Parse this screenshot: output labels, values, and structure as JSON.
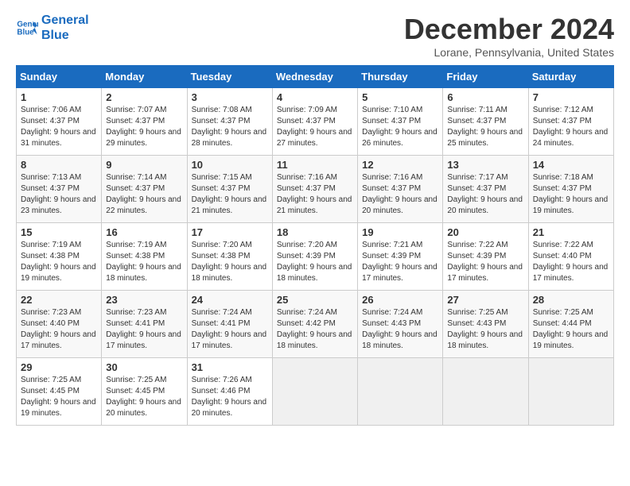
{
  "logo": {
    "line1": "General",
    "line2": "Blue"
  },
  "title": "December 2024",
  "location": "Lorane, Pennsylvania, United States",
  "days_of_week": [
    "Sunday",
    "Monday",
    "Tuesday",
    "Wednesday",
    "Thursday",
    "Friday",
    "Saturday"
  ],
  "weeks": [
    [
      {
        "day": "1",
        "sunrise": "7:06 AM",
        "sunset": "4:37 PM",
        "daylight": "9 hours and 31 minutes."
      },
      {
        "day": "2",
        "sunrise": "7:07 AM",
        "sunset": "4:37 PM",
        "daylight": "9 hours and 29 minutes."
      },
      {
        "day": "3",
        "sunrise": "7:08 AM",
        "sunset": "4:37 PM",
        "daylight": "9 hours and 28 minutes."
      },
      {
        "day": "4",
        "sunrise": "7:09 AM",
        "sunset": "4:37 PM",
        "daylight": "9 hours and 27 minutes."
      },
      {
        "day": "5",
        "sunrise": "7:10 AM",
        "sunset": "4:37 PM",
        "daylight": "9 hours and 26 minutes."
      },
      {
        "day": "6",
        "sunrise": "7:11 AM",
        "sunset": "4:37 PM",
        "daylight": "9 hours and 25 minutes."
      },
      {
        "day": "7",
        "sunrise": "7:12 AM",
        "sunset": "4:37 PM",
        "daylight": "9 hours and 24 minutes."
      }
    ],
    [
      {
        "day": "8",
        "sunrise": "7:13 AM",
        "sunset": "4:37 PM",
        "daylight": "9 hours and 23 minutes."
      },
      {
        "day": "9",
        "sunrise": "7:14 AM",
        "sunset": "4:37 PM",
        "daylight": "9 hours and 22 minutes."
      },
      {
        "day": "10",
        "sunrise": "7:15 AM",
        "sunset": "4:37 PM",
        "daylight": "9 hours and 21 minutes."
      },
      {
        "day": "11",
        "sunrise": "7:16 AM",
        "sunset": "4:37 PM",
        "daylight": "9 hours and 21 minutes."
      },
      {
        "day": "12",
        "sunrise": "7:16 AM",
        "sunset": "4:37 PM",
        "daylight": "9 hours and 20 minutes."
      },
      {
        "day": "13",
        "sunrise": "7:17 AM",
        "sunset": "4:37 PM",
        "daylight": "9 hours and 20 minutes."
      },
      {
        "day": "14",
        "sunrise": "7:18 AM",
        "sunset": "4:37 PM",
        "daylight": "9 hours and 19 minutes."
      }
    ],
    [
      {
        "day": "15",
        "sunrise": "7:19 AM",
        "sunset": "4:38 PM",
        "daylight": "9 hours and 19 minutes."
      },
      {
        "day": "16",
        "sunrise": "7:19 AM",
        "sunset": "4:38 PM",
        "daylight": "9 hours and 18 minutes."
      },
      {
        "day": "17",
        "sunrise": "7:20 AM",
        "sunset": "4:38 PM",
        "daylight": "9 hours and 18 minutes."
      },
      {
        "day": "18",
        "sunrise": "7:20 AM",
        "sunset": "4:39 PM",
        "daylight": "9 hours and 18 minutes."
      },
      {
        "day": "19",
        "sunrise": "7:21 AM",
        "sunset": "4:39 PM",
        "daylight": "9 hours and 17 minutes."
      },
      {
        "day": "20",
        "sunrise": "7:22 AM",
        "sunset": "4:39 PM",
        "daylight": "9 hours and 17 minutes."
      },
      {
        "day": "21",
        "sunrise": "7:22 AM",
        "sunset": "4:40 PM",
        "daylight": "9 hours and 17 minutes."
      }
    ],
    [
      {
        "day": "22",
        "sunrise": "7:23 AM",
        "sunset": "4:40 PM",
        "daylight": "9 hours and 17 minutes."
      },
      {
        "day": "23",
        "sunrise": "7:23 AM",
        "sunset": "4:41 PM",
        "daylight": "9 hours and 17 minutes."
      },
      {
        "day": "24",
        "sunrise": "7:24 AM",
        "sunset": "4:41 PM",
        "daylight": "9 hours and 17 minutes."
      },
      {
        "day": "25",
        "sunrise": "7:24 AM",
        "sunset": "4:42 PM",
        "daylight": "9 hours and 18 minutes."
      },
      {
        "day": "26",
        "sunrise": "7:24 AM",
        "sunset": "4:43 PM",
        "daylight": "9 hours and 18 minutes."
      },
      {
        "day": "27",
        "sunrise": "7:25 AM",
        "sunset": "4:43 PM",
        "daylight": "9 hours and 18 minutes."
      },
      {
        "day": "28",
        "sunrise": "7:25 AM",
        "sunset": "4:44 PM",
        "daylight": "9 hours and 19 minutes."
      }
    ],
    [
      {
        "day": "29",
        "sunrise": "7:25 AM",
        "sunset": "4:45 PM",
        "daylight": "9 hours and 19 minutes."
      },
      {
        "day": "30",
        "sunrise": "7:25 AM",
        "sunset": "4:45 PM",
        "daylight": "9 hours and 20 minutes."
      },
      {
        "day": "31",
        "sunrise": "7:26 AM",
        "sunset": "4:46 PM",
        "daylight": "9 hours and 20 minutes."
      },
      null,
      null,
      null,
      null
    ]
  ]
}
